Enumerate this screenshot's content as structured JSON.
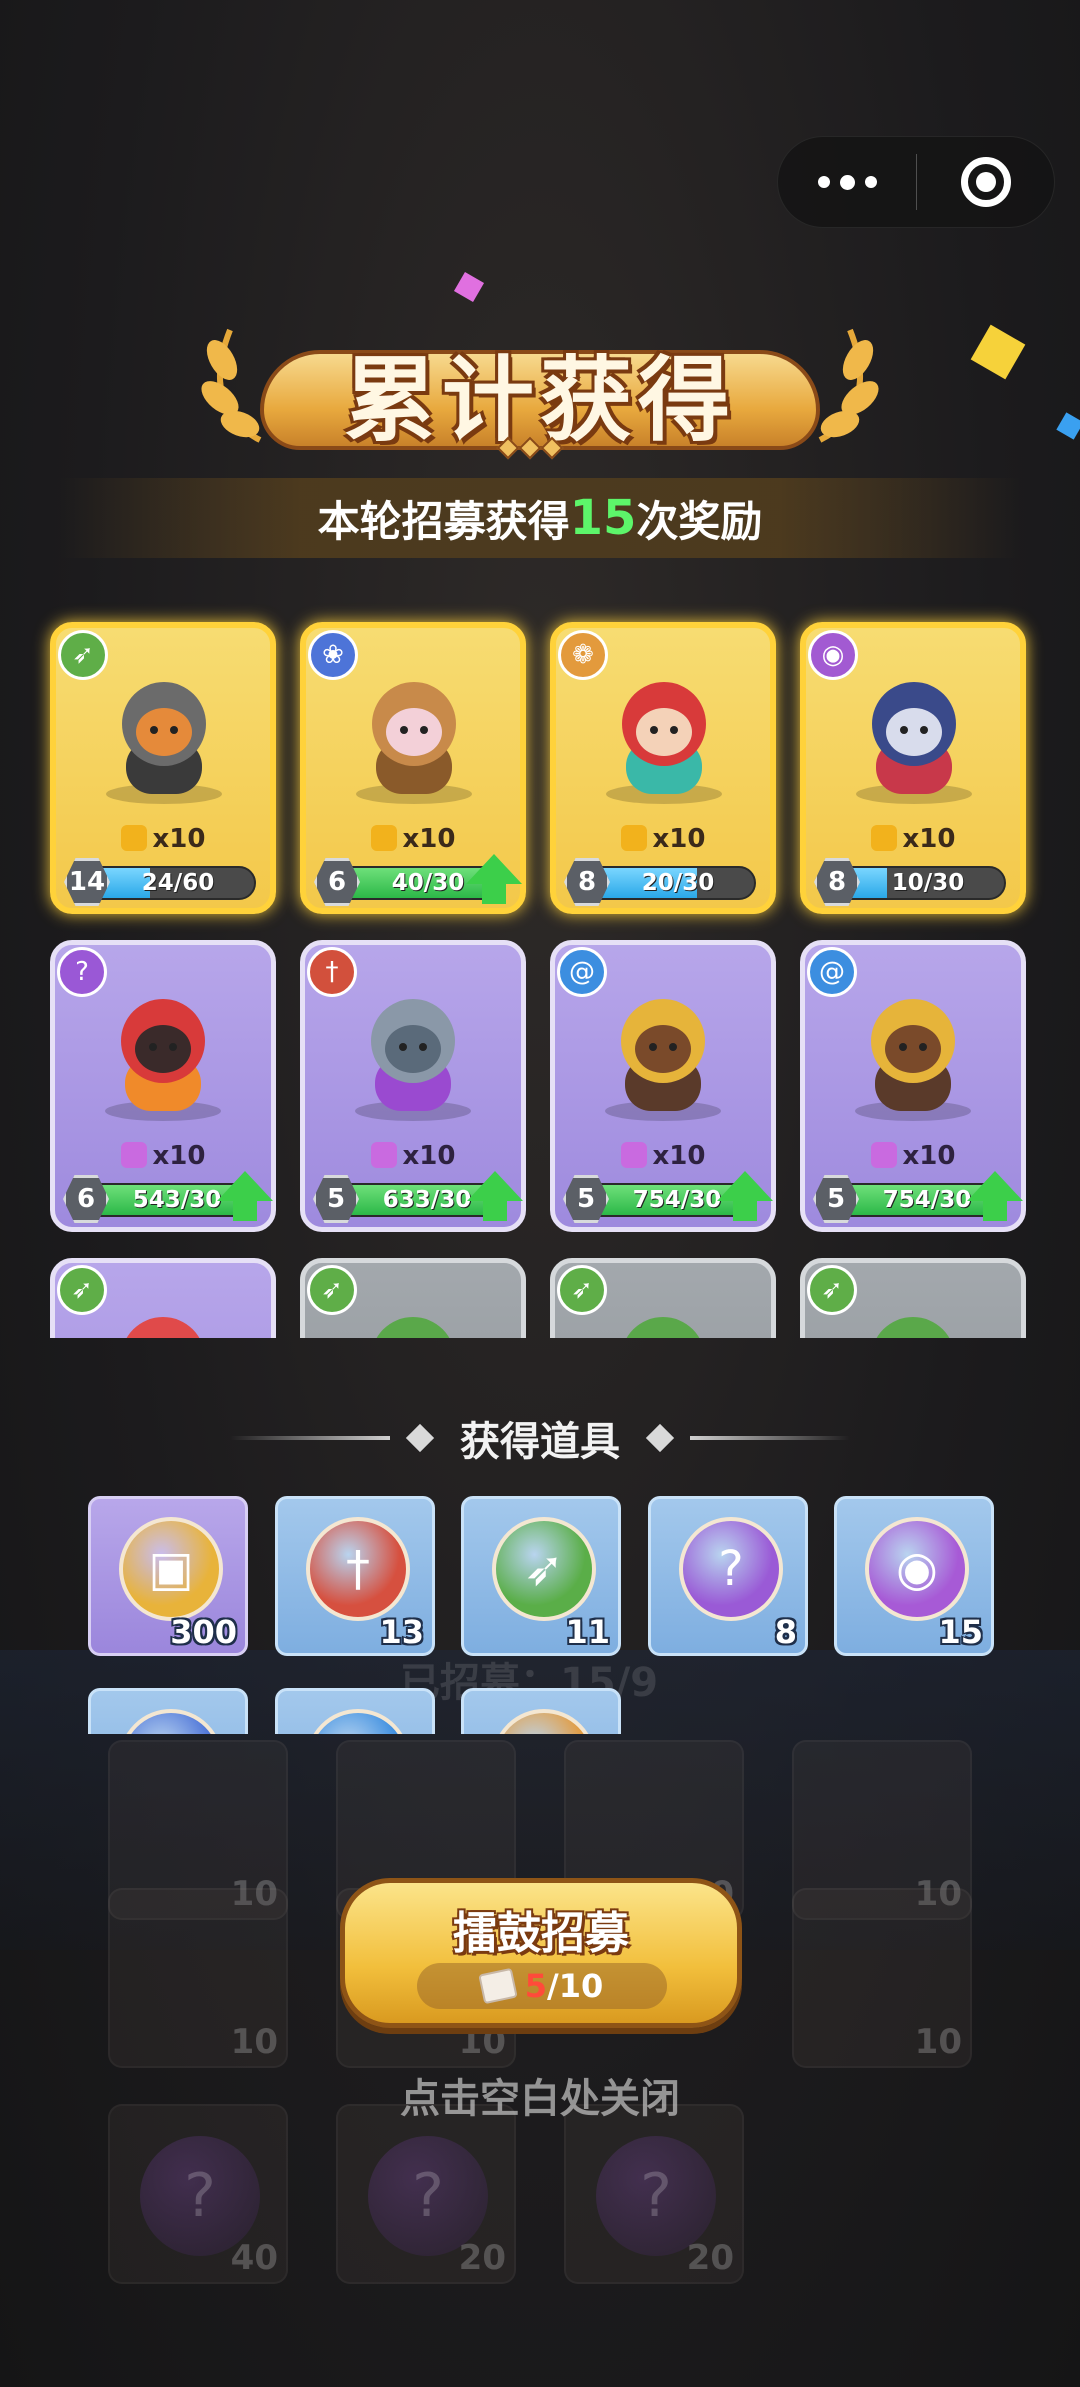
{
  "capsule": {
    "more_icon": "more-dots-icon",
    "close_icon": "target-close-icon"
  },
  "banner": {
    "title": "累计获得"
  },
  "summary": {
    "prefix": "本轮招募获得",
    "count": "15",
    "suffix": "次奖励"
  },
  "heroes": [
    {
      "rarity": "gold",
      "class_icon": "bow-icon",
      "badge_color": "#5fae48",
      "shards": "x10",
      "level": "14",
      "progress_text": "24/60",
      "progress": 0.4,
      "upgradable": false,
      "portrait": "raccoon-gunner"
    },
    {
      "rarity": "gold",
      "class_icon": "paw-icon",
      "badge_color": "#4d74d8",
      "shards": "x10",
      "level": "6",
      "progress_text": "40/30",
      "progress": 1.0,
      "upgradable": true,
      "portrait": "bear-hood-girl"
    },
    {
      "rarity": "gold",
      "class_icon": "wing-icon",
      "badge_color": "#e39a3c",
      "shards": "x10",
      "level": "8",
      "progress_text": "20/30",
      "progress": 0.67,
      "upgradable": false,
      "portrait": "mermaid"
    },
    {
      "rarity": "gold",
      "class_icon": "eye-icon",
      "badge_color": "#a25ad2",
      "shards": "x10",
      "level": "8",
      "progress_text": "10/30",
      "progress": 0.33,
      "upgradable": false,
      "portrait": "pirate-shark"
    },
    {
      "rarity": "purple",
      "class_icon": "staff-icon",
      "badge_color": "#9a58d6",
      "shards": "x10",
      "level": "6",
      "progress_text": "543/30",
      "progress": 1.0,
      "upgradable": true,
      "portrait": "fire-imp"
    },
    {
      "rarity": "purple",
      "class_icon": "sword-icon",
      "badge_color": "#d2503c",
      "shards": "x10",
      "level": "5",
      "progress_text": "633/30",
      "progress": 1.0,
      "upgradable": true,
      "portrait": "armored-knight"
    },
    {
      "rarity": "purple",
      "class_icon": "swirl-icon",
      "badge_color": "#3c8ee0",
      "shards": "x10",
      "level": "5",
      "progress_text": "754/30",
      "progress": 1.0,
      "upgradable": true,
      "portrait": "miner-mole"
    },
    {
      "rarity": "purple",
      "class_icon": "swirl-icon",
      "badge_color": "#3c8ee0",
      "shards": "x10",
      "level": "5",
      "progress_text": "754/30",
      "progress": 1.0,
      "upgradable": true,
      "portrait": "miner-mole"
    },
    {
      "rarity": "purple",
      "class_icon": "bow-icon",
      "badge_color": "#5fae48",
      "portrait": "jester"
    },
    {
      "rarity": "grey",
      "class_icon": "bow-icon",
      "badge_color": "#5fae48",
      "portrait": "archer-leaf"
    },
    {
      "rarity": "grey",
      "class_icon": "bow-icon",
      "badge_color": "#5fae48",
      "portrait": "archer-leaf"
    },
    {
      "rarity": "grey",
      "class_icon": "bow-icon",
      "badge_color": "#5fae48",
      "portrait": "archer-leaf"
    }
  ],
  "items_section": {
    "title": "获得道具"
  },
  "items": [
    {
      "icon": "gold-coin-icon",
      "count": "300",
      "tile": "purple",
      "orb_color": "#e8b33a"
    },
    {
      "icon": "sword-icon",
      "count": "13",
      "tile": "blue",
      "orb_color": "#d6503f"
    },
    {
      "icon": "bow-icon",
      "count": "11",
      "tile": "blue",
      "orb_color": "#5aae48"
    },
    {
      "icon": "staff-icon",
      "count": "8",
      "tile": "blue",
      "orb_color": "#9a5ad6"
    },
    {
      "icon": "eye-icon",
      "count": "15",
      "tile": "blue",
      "orb_color": "#a75ad6"
    },
    {
      "icon": "paw-icon",
      "count": "",
      "tile": "blue",
      "orb_color": "#4d74d8"
    },
    {
      "icon": "swirl-icon",
      "count": "",
      "tile": "blue",
      "orb_color": "#3c8ee0"
    },
    {
      "icon": "wing-icon",
      "count": "",
      "tile": "blue",
      "orb_color": "#e39a3c"
    }
  ],
  "background": {
    "recruited_label": "已招募：15/9",
    "tile_counts": [
      "10",
      "10",
      "10",
      "10",
      "10",
      "10",
      "10",
      "40",
      "20",
      "20"
    ]
  },
  "recruit_button": {
    "label": "擂鼓招募",
    "have": "5",
    "need": "/10"
  },
  "close_hint": "点击空白处关闭"
}
